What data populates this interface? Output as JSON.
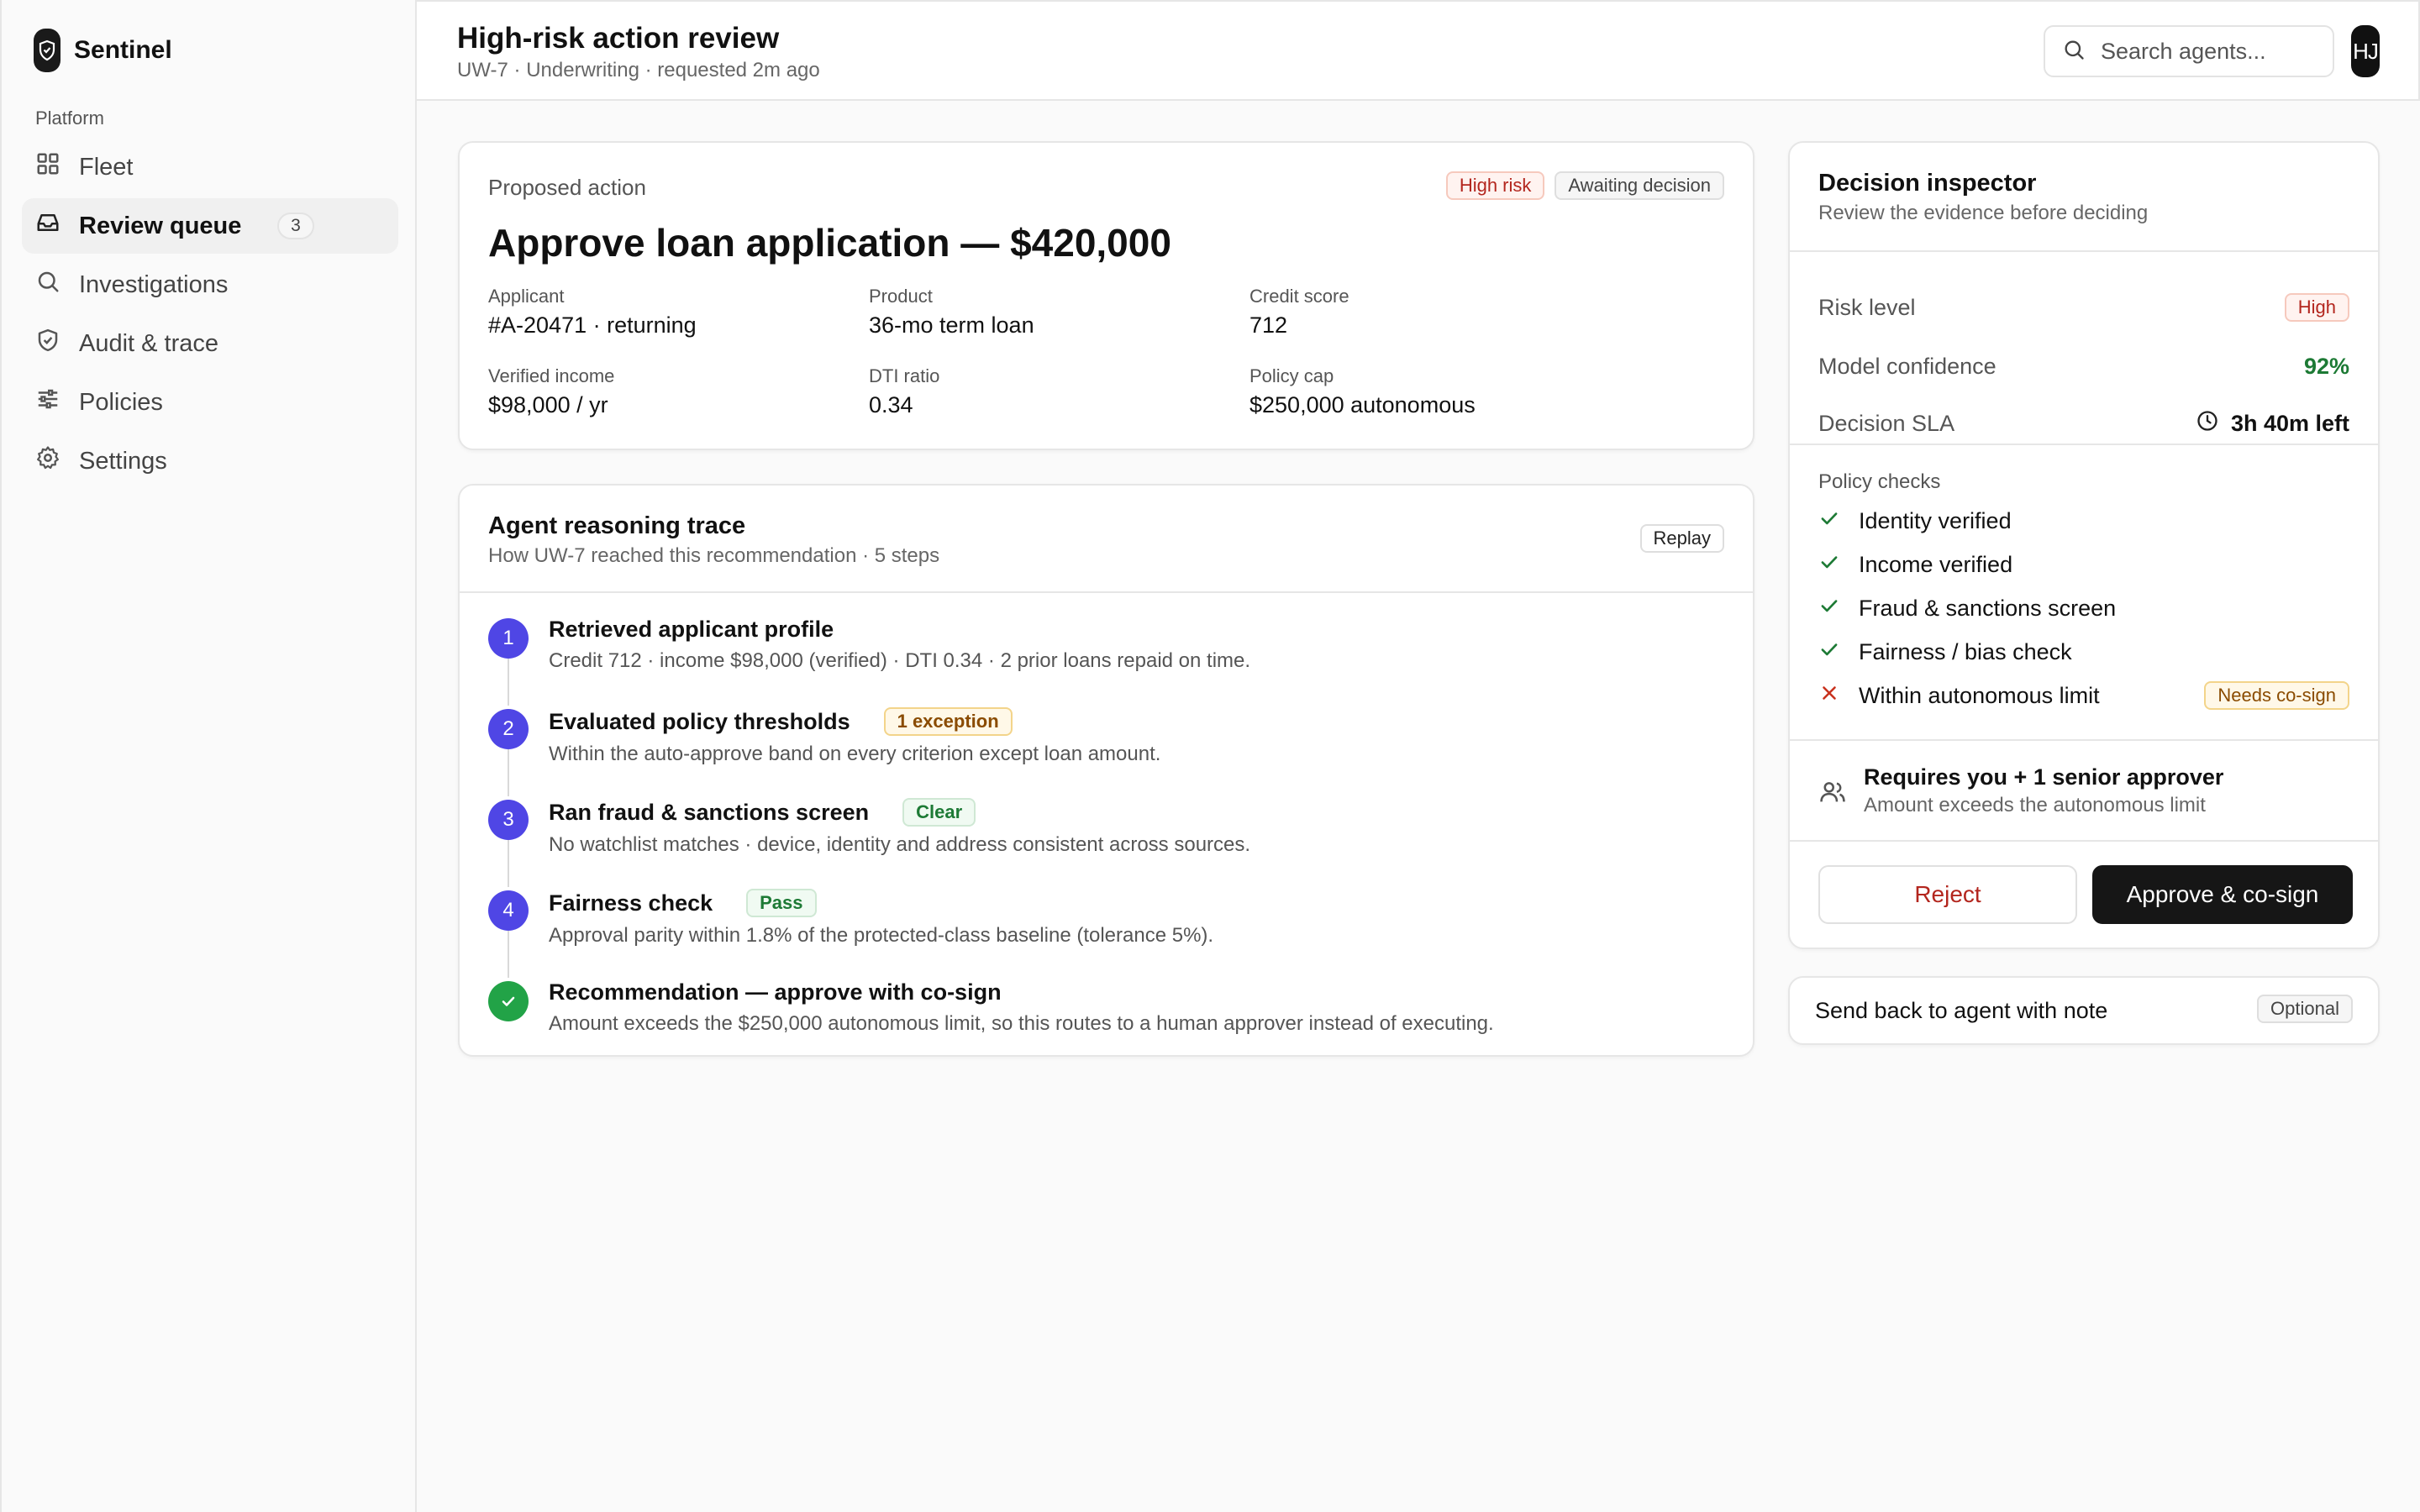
{
  "brand": {
    "name": "Sentinel"
  },
  "sidebar": {
    "section": "Platform",
    "items": [
      {
        "label": "Fleet",
        "icon": "grid-icon"
      },
      {
        "label": "Review queue",
        "icon": "inbox-icon",
        "badge": "3",
        "active": true
      },
      {
        "label": "Investigations",
        "icon": "search-icon"
      },
      {
        "label": "Audit & trace",
        "icon": "shield-icon"
      },
      {
        "label": "Policies",
        "icon": "sliders-icon"
      },
      {
        "label": "Settings",
        "icon": "gear-icon"
      }
    ]
  },
  "header": {
    "title": "High-risk action review",
    "subtitle": "UW-7 · Underwriting · requested 2m ago",
    "search_placeholder": "Search agents...",
    "avatar": "HJ"
  },
  "proposed": {
    "label": "Proposed action",
    "badges": {
      "risk": "High risk",
      "status": "Awaiting decision"
    },
    "title": "Approve loan application — $420,000",
    "fields": [
      {
        "label": "Applicant",
        "value": "#A-20471 · returning"
      },
      {
        "label": "Product",
        "value": "36-mo term loan"
      },
      {
        "label": "Credit score",
        "value": "712"
      },
      {
        "label": "Verified income",
        "value": "$98,000 / yr"
      },
      {
        "label": "DTI ratio",
        "value": "0.34"
      },
      {
        "label": "Policy cap",
        "value": "$250,000 autonomous"
      }
    ]
  },
  "trace": {
    "title": "Agent reasoning trace",
    "subtitle": "How UW-7 reached this recommendation · 5 steps",
    "replay_label": "Replay",
    "steps": [
      {
        "num": "1",
        "title": "Retrieved applicant profile",
        "desc": "Credit 712 · income $98,000 (verified) · DTI 0.34 · 2 prior loans repaid on time."
      },
      {
        "num": "2",
        "title": "Evaluated policy thresholds",
        "badge": "1 exception",
        "desc": "Within the auto-approve band on every criterion except loan amount."
      },
      {
        "num": "3",
        "title": "Ran fraud & sanctions screen",
        "badge": "Clear",
        "desc": "No watchlist matches · device, identity and address consistent across sources."
      },
      {
        "num": "4",
        "title": "Fairness check",
        "badge": "Pass",
        "desc": "Approval parity within 1.8% of the protected-class baseline (tolerance 5%)."
      },
      {
        "num": "✓",
        "title": "Recommendation — approve with co-sign",
        "desc": "Amount exceeds the $250,000 autonomous limit, so this routes to a human approver instead of executing."
      }
    ]
  },
  "inspector": {
    "title": "Decision inspector",
    "subtitle": "Review the evidence before deciding",
    "risk_label": "Risk level",
    "risk_value": "High",
    "confidence_label": "Model confidence",
    "confidence_value": "92%",
    "sla_label": "Decision SLA",
    "sla_value": "3h 40m left",
    "checks_label": "Policy checks",
    "checks": [
      {
        "label": "Identity verified",
        "status": "pass"
      },
      {
        "label": "Income verified",
        "status": "pass"
      },
      {
        "label": "Fraud & sanctions screen",
        "status": "pass"
      },
      {
        "label": "Fairness / bias check",
        "status": "pass"
      },
      {
        "label": "Within autonomous limit",
        "status": "fail",
        "badge": "Needs co-sign"
      }
    ],
    "approver_title": "Requires you + 1 senior approver",
    "approver_sub": "Amount exceeds the autonomous limit",
    "reject_label": "Reject",
    "approve_label": "Approve & co-sign"
  },
  "sendback": {
    "label": "Send back to agent with note",
    "badge": "Optional"
  },
  "colors": {
    "accent": "#4f46e5",
    "success": "#22a347",
    "danger": "#b3261e",
    "dark": "#161616"
  }
}
